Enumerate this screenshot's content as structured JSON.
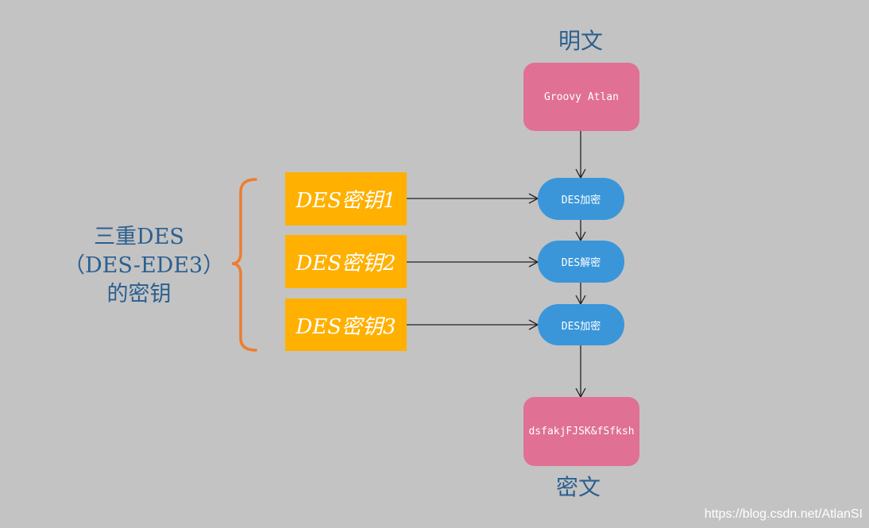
{
  "plaintext": {
    "label": "明文",
    "value": "Groovy Atlan"
  },
  "ciphertext": {
    "label": "密文",
    "value": "dsfakjFJSK&fSfksh"
  },
  "steps": [
    {
      "label": "DES加密"
    },
    {
      "label": "DES解密"
    },
    {
      "label": "DES加密"
    }
  ],
  "keys": [
    {
      "label": "DES密钥1"
    },
    {
      "label": "DES密钥2"
    },
    {
      "label": "DES密钥3"
    }
  ],
  "left_label": {
    "line1": "三重DES",
    "line2": "（DES-EDE3）",
    "line3": "的密钥"
  },
  "watermark": "https://blog.csdn.net/AtlanSI",
  "colors": {
    "background": "#c3c3c3",
    "pink": "#e07094",
    "blue": "#3a96d9",
    "orange": "#ffb000",
    "brace": "#ed7d31",
    "title": "#2b5f8f"
  }
}
